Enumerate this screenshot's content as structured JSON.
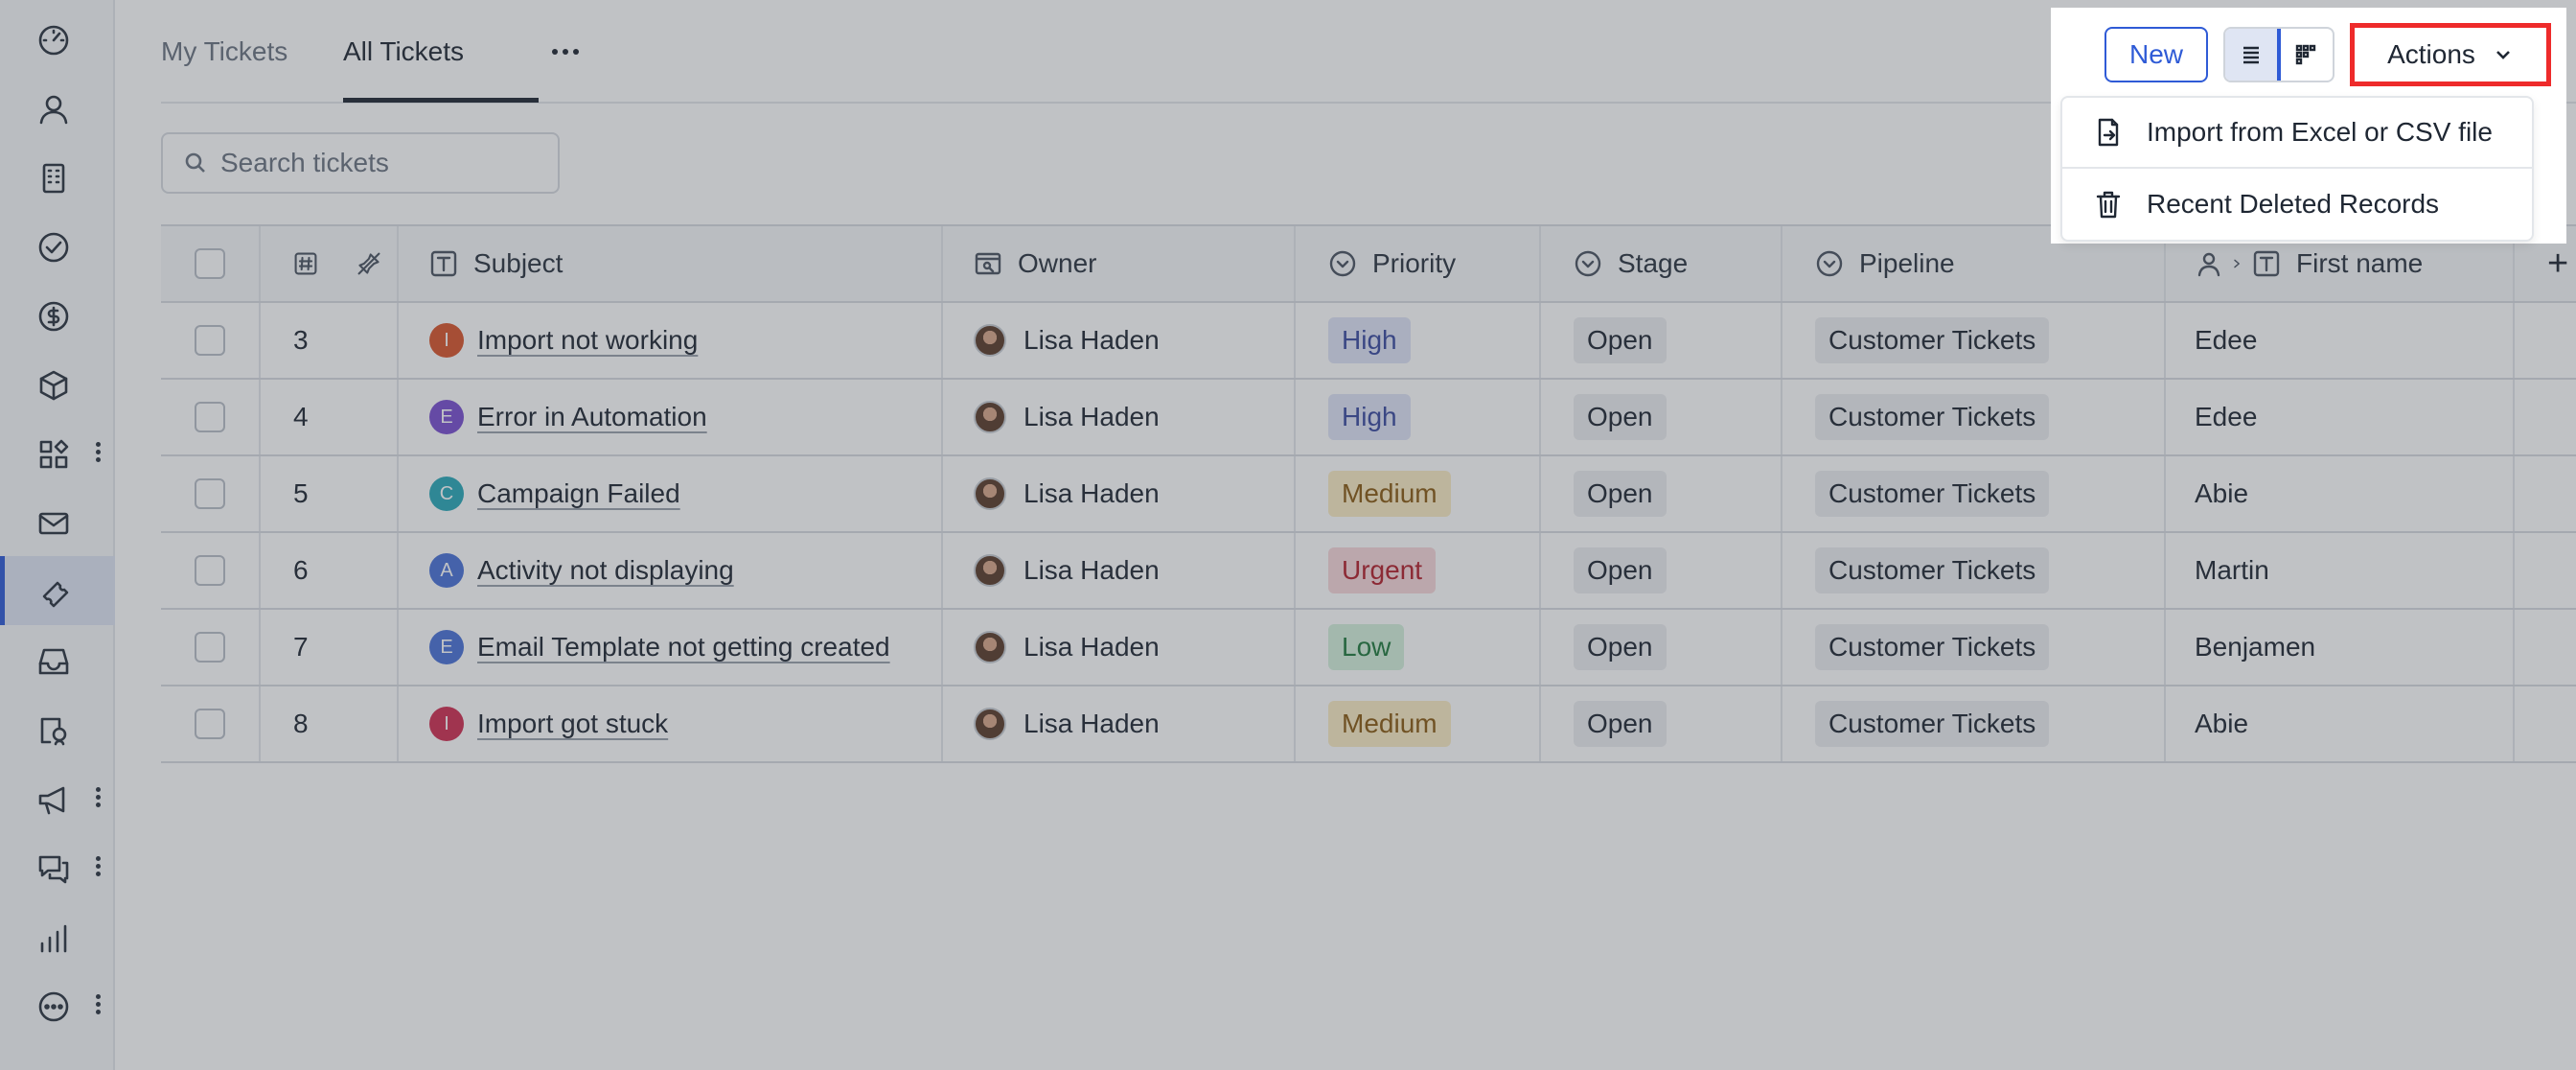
{
  "sidebar": {
    "items": [
      {
        "icon": "dashboard-icon"
      },
      {
        "icon": "contact-icon"
      },
      {
        "icon": "company-icon"
      },
      {
        "icon": "task-icon"
      },
      {
        "icon": "deal-icon"
      },
      {
        "icon": "product-icon"
      },
      {
        "icon": "apps-icon",
        "more": true
      },
      {
        "icon": "email-icon"
      },
      {
        "icon": "ticket-icon",
        "active": true
      },
      {
        "icon": "inbox-icon"
      },
      {
        "icon": "form-icon"
      },
      {
        "icon": "campaign-icon",
        "more": true
      },
      {
        "icon": "chat-icon",
        "more": true
      },
      {
        "icon": "reports-icon"
      },
      {
        "icon": "more-icon",
        "more": true
      }
    ]
  },
  "tabs": {
    "my_tickets": "My Tickets",
    "all_tickets": "All Tickets"
  },
  "search": {
    "placeholder": "Search tickets"
  },
  "toolbar": {
    "new_label": "New",
    "actions_label": "Actions"
  },
  "menu": {
    "import_label": "Import from Excel or CSV file",
    "deleted_label": "Recent Deleted Records"
  },
  "table": {
    "headers": {
      "number": "",
      "subject": "Subject",
      "owner": "Owner",
      "priority": "Priority",
      "stage": "Stage",
      "pipeline": "Pipeline",
      "first_name": "First name"
    },
    "rows": [
      {
        "id": "3",
        "letter": "I",
        "letter_color": "#d9542b",
        "subject": "Import not working",
        "owner": "Lisa Haden",
        "priority": "High",
        "priority_class": "p-high",
        "stage": "Open",
        "pipeline": "Customer Tickets",
        "first_name": "Edee"
      },
      {
        "id": "4",
        "letter": "E",
        "letter_color": "#7a4fd0",
        "subject": "Error in Automation",
        "owner": "Lisa Haden",
        "priority": "High",
        "priority_class": "p-high",
        "stage": "Open",
        "pipeline": "Customer Tickets",
        "first_name": "Edee"
      },
      {
        "id": "5",
        "letter": "C",
        "letter_color": "#2aa8b8",
        "subject": "Campaign Failed",
        "owner": "Lisa Haden",
        "priority": "Medium",
        "priority_class": "p-med",
        "stage": "Open",
        "pipeline": "Customer Tickets",
        "first_name": "Abie"
      },
      {
        "id": "6",
        "letter": "A",
        "letter_color": "#4a72d8",
        "subject": "Activity not displaying",
        "owner": "Lisa Haden",
        "priority": "Urgent",
        "priority_class": "p-urg",
        "stage": "Open",
        "pipeline": "Customer Tickets",
        "first_name": "Martin"
      },
      {
        "id": "7",
        "letter": "E",
        "letter_color": "#4a72d8",
        "subject": "Email Template not getting created",
        "owner": "Lisa Haden",
        "priority": "Low",
        "priority_class": "p-low",
        "stage": "Open",
        "pipeline": "Customer Tickets",
        "first_name": "Benjamen"
      },
      {
        "id": "8",
        "letter": "I",
        "letter_color": "#d02f52",
        "subject": "Import got stuck",
        "owner": "Lisa Haden",
        "priority": "Medium",
        "priority_class": "p-med",
        "stage": "Open",
        "pipeline": "Customer Tickets",
        "first_name": "Abie"
      }
    ]
  },
  "colors": {
    "accent": "#2f5bd6",
    "highlight_border": "#ee2b2b"
  }
}
